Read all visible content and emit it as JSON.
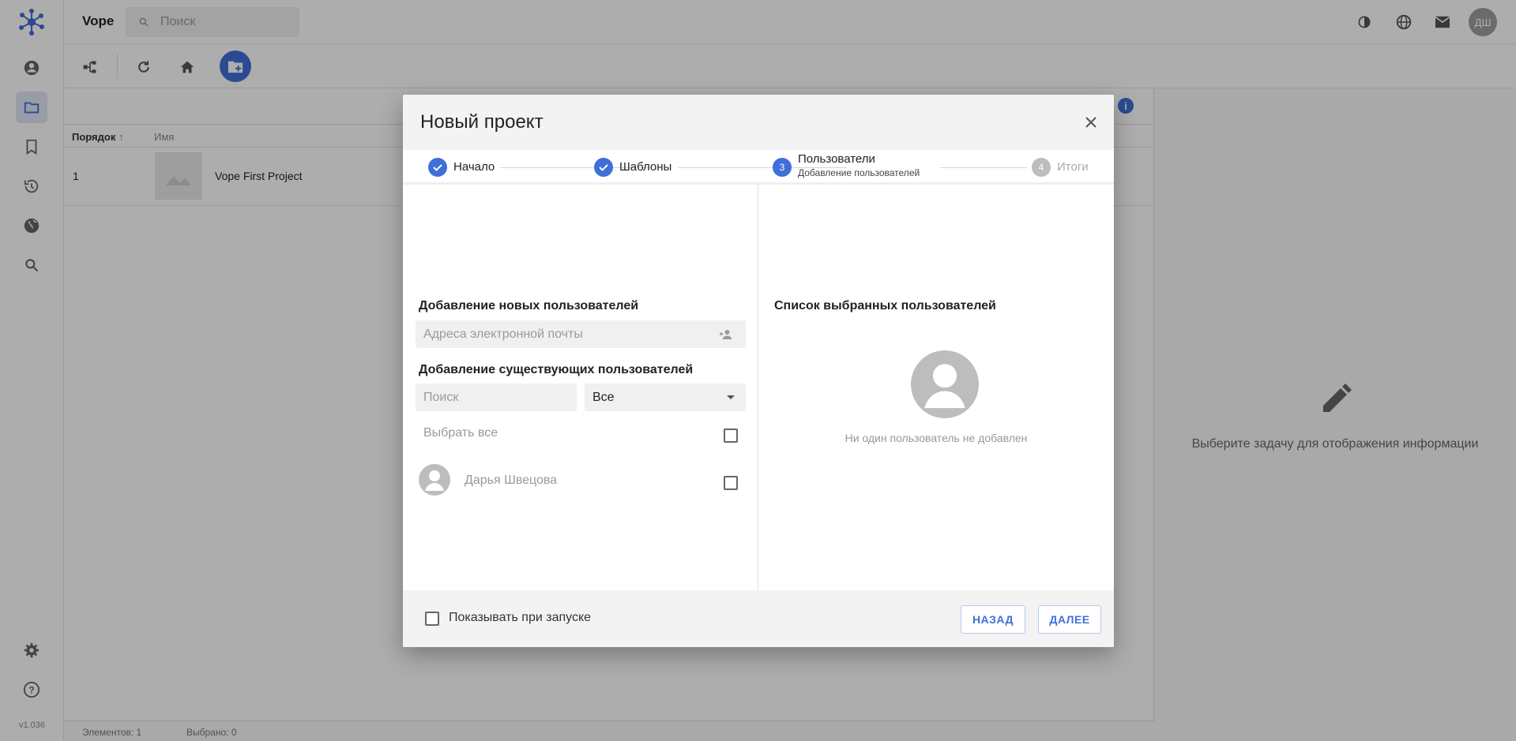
{
  "app": {
    "name": "Vope",
    "version": "v1.036"
  },
  "search": {
    "placeholder": "Поиск"
  },
  "user": {
    "initials": "ДШ"
  },
  "table": {
    "columns": [
      "Порядок",
      "Имя"
    ],
    "rows": [
      {
        "order": "1",
        "name": "Vope First Project"
      }
    ]
  },
  "status": {
    "elements": "Элементов: 1",
    "selected": "Выбрано: 0"
  },
  "details": {
    "empty_message": "Выберите задачу для отображения информации"
  },
  "dialog": {
    "title": "Новый проект",
    "steps": [
      {
        "label": "Начало",
        "state": "done"
      },
      {
        "label": "Шаблоны",
        "state": "done"
      },
      {
        "num": "3",
        "label": "Пользователи",
        "sub": "Добавление пользователей",
        "state": "active"
      },
      {
        "num": "4",
        "label": "Итоги",
        "state": "pending"
      }
    ],
    "add_new_title": "Добавление новых пользователей",
    "email_placeholder": "Адреса электронной почты",
    "add_existing_title": "Добавление существующих пользователей",
    "search_placeholder": "Поиск",
    "filter_value": "Все",
    "select_all": "Выбрать все",
    "users": [
      {
        "name": "Дарья Швецова"
      }
    ],
    "selected_title": "Список выбранных пользователей",
    "no_users": "Ни один пользователь не добавлен",
    "show_on_start": "Показывать при запуске",
    "back_label": "НАЗАД",
    "next_label": "ДАЛЕЕ"
  },
  "colors": {
    "accent": "#3f6fd8",
    "overlay": "rgba(0,0,0,0.32)"
  }
}
